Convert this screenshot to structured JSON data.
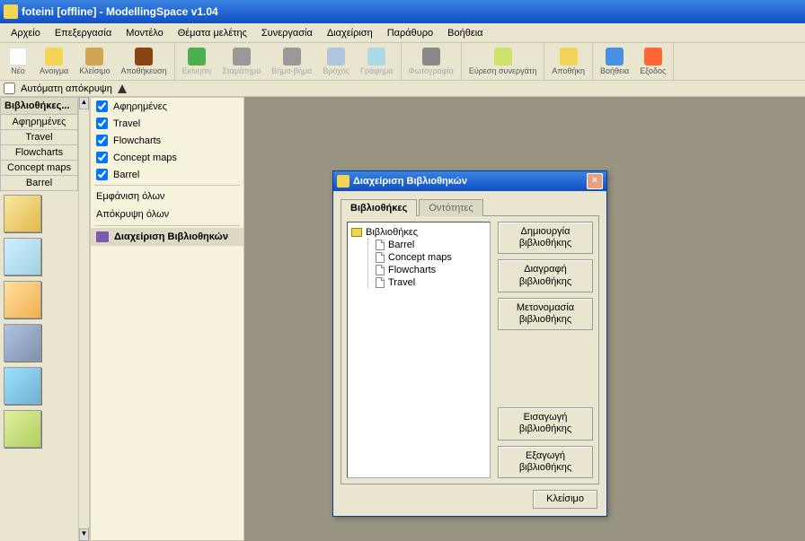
{
  "window": {
    "title": "foteini [offline] - ModellingSpace v1.04"
  },
  "menu": [
    "Αρχείο",
    "Επεξεργασία",
    "Μοντέλο",
    "Θέματα μελέτης",
    "Συνεργασία",
    "Διαχείριση",
    "Παράθυρο",
    "Βοήθεια"
  ],
  "toolbar": {
    "new": "Νέο",
    "open": "Ανοιγμα",
    "close": "Κλείσιμο",
    "save": "Αποθήκευση",
    "run": "Εκίνηση",
    "stop": "Σταμάτημα",
    "step": "Βήμα-βήμα",
    "loop": "Βρόχος",
    "chart": "Γράφημα",
    "photo": "Φωτογραφία",
    "find": "Εύρεση συνεργάτη",
    "savedb": "Αποθήκη",
    "help": "Βοήθεια",
    "exit": "Εξοδος"
  },
  "subtoolbar": {
    "autohide": "Αυτόματη απόκρυψη"
  },
  "sidebar": {
    "header": "Βιβλιοθήκες...",
    "tabs": [
      "Αφηρημένες",
      "Travel",
      "Flowcharts",
      "Concept maps",
      "Barrel"
    ]
  },
  "midpanel": {
    "checks": [
      "Αφηρημένες",
      "Travel",
      "Flowcharts",
      "Concept maps",
      "Barrel"
    ],
    "show_all": "Εμφάνιση όλων",
    "hide_all": "Απόκρυψη όλων",
    "manage": "Διαχείριση Βιβλιοθηκών"
  },
  "dialog": {
    "title": "Διαχείριση Βιβλιοθηκών",
    "tabs": {
      "libs": "Βιβλιοθήκες",
      "entities": "Οντότητες"
    },
    "tree_root": "Βιβλιοθήκες",
    "tree_items": [
      "Barrel",
      "Concept maps",
      "Flowcharts",
      "Travel"
    ],
    "buttons": {
      "create": "Δημιουργία βιβλιοθήκης",
      "delete": "Διαγραφή βιβλιοθήκης",
      "rename": "Μετονομασία βιβλιοθήκης",
      "import": "Εισαγωγή βιβλιοθήκης",
      "export": "Εξαγωγή βιβλιοθήκης",
      "close": "Κλείσιμο"
    }
  }
}
